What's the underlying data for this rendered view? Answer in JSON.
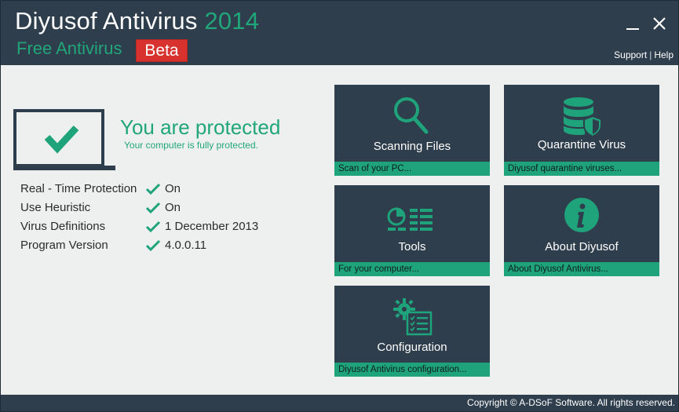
{
  "header": {
    "app_name": "Diyusof Antivirus",
    "year": "2014",
    "edition": "Free Antivirus",
    "badge": "Beta",
    "links": {
      "support": "Support",
      "separator": "|",
      "help": "Help"
    }
  },
  "window_controls": {
    "minimize_icon": "minimize-icon",
    "close_icon": "close-icon"
  },
  "status": {
    "title": "You are protected",
    "subtitle": "Your computer is fully protected.",
    "icon": "laptop-check-icon"
  },
  "info": [
    {
      "label": "Real - Time Protection",
      "value": "On"
    },
    {
      "label": "Use Heuristic",
      "value": "On"
    },
    {
      "label": "Virus Definitions",
      "value": "1 December 2013"
    },
    {
      "label": "Program Version",
      "value": "4.0.0.11"
    }
  ],
  "tiles": [
    {
      "label": "Scanning Files",
      "desc": "Scan of your PC...",
      "icon": "magnifier-icon"
    },
    {
      "label": "Quarantine Virus",
      "desc": "Diyusof quarantine viruses...",
      "icon": "database-shield-icon"
    },
    {
      "label": "Tools",
      "desc": "For your computer...",
      "icon": "tools-chart-icon"
    },
    {
      "label": "About Diyusof",
      "desc": "About Diyusof Antivirus...",
      "icon": "info-icon"
    },
    {
      "label": "Configuration",
      "desc": "Diyusof Antivirus configuration...",
      "icon": "gear-checklist-icon"
    }
  ],
  "footer": {
    "copyright": "Copyright © A-DSoF Software. All rights reserved."
  },
  "colors": {
    "header_bg": "#2f3e4d",
    "accent_green": "#21a67a",
    "tile_strip": "#1fa37a",
    "beta_red": "#d8322e",
    "body_bg": "#eef0ef"
  }
}
